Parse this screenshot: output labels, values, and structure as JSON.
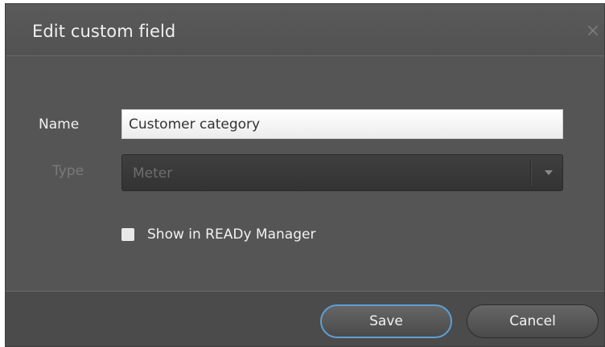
{
  "dialog": {
    "title": "Edit custom field",
    "close_glyph": "×"
  },
  "form": {
    "name_label": "Name",
    "name_value": "Customer category",
    "type_label": "Type",
    "type_value": "Meter",
    "type_disabled": true,
    "show_checkbox_label": "Show in READy Manager",
    "show_checkbox_checked": false
  },
  "footer": {
    "save_label": "Save",
    "cancel_label": "Cancel"
  },
  "icons": {
    "close": "close-icon",
    "dropdown": "chevron-down-icon"
  },
  "colors": {
    "dialog_background": "#555555",
    "focus_ring": "#5e9fd3"
  }
}
